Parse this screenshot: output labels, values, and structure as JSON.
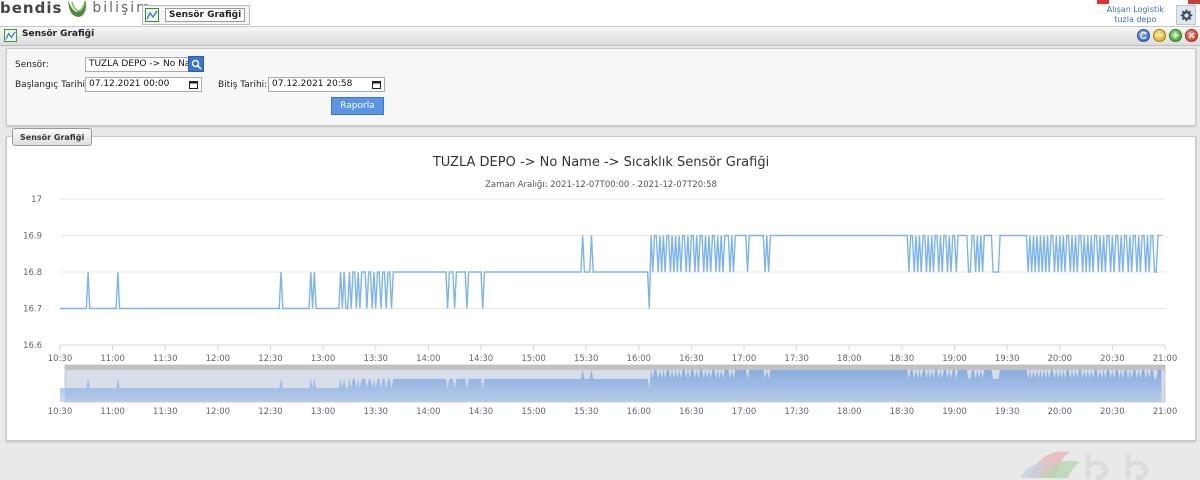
{
  "app": {
    "logo_left": "bendis",
    "logo_right": "bilişim",
    "open_tab": "Sensör Grafiği",
    "user_name": "Alışan Logistik",
    "user_site": "tuzla depo"
  },
  "window": {
    "title": "Sensör Grafiği"
  },
  "filters": {
    "sensor_label": "Sensör:",
    "sensor_value": "TUZLA DEPO -> No Name",
    "start_label": "Başlangıç Tarihi:",
    "start_value": "07.12.2021 00:00",
    "end_label": "Bitiş Tarihi:",
    "end_value": "07.12.2021 20:58",
    "report_button": "Raporla"
  },
  "section_tab": "Sensör Grafiği",
  "chart_data": {
    "type": "line",
    "title": "TUZLA DEPO -> No Name -> Sıcaklık Sensör Grafiği",
    "subtitle": "Zaman Aralığı: 2021-12-07T00:00 - 2021-12-07T20:58",
    "xlabel": "",
    "ylabel": "",
    "ylim": [
      16.6,
      17
    ],
    "yticks": [
      "17",
      "16.9",
      "16.8",
      "16.7",
      "16.6"
    ],
    "xticks": [
      "10:30",
      "11:00",
      "11:30",
      "12:00",
      "12:30",
      "13:00",
      "13:30",
      "14:00",
      "14:30",
      "15:00",
      "15:30",
      "16:00",
      "16:30",
      "17:00",
      "17:30",
      "18:00",
      "18:30",
      "19:00",
      "19:30",
      "20:00",
      "20:30",
      "21:00"
    ],
    "xlim": [
      "10:30",
      "21:00"
    ],
    "grid": "horizontal",
    "series_color": "#7cb5ec",
    "navigator": true,
    "x": [
      "10:30",
      "10:45",
      "10:46",
      "10:47",
      "11:02",
      "11:03",
      "11:04",
      "12:35",
      "12:36",
      "12:37",
      "12:52",
      "12:53",
      "12:54",
      "12:55",
      "12:56",
      "12:57",
      "13:09",
      "13:10",
      "13:11",
      "13:12",
      "13:13",
      "13:14",
      "13:15",
      "13:16",
      "13:17",
      "13:18",
      "13:19",
      "13:20",
      "13:21",
      "13:22",
      "13:23",
      "13:24",
      "13:25",
      "13:26",
      "13:27",
      "13:28",
      "13:29",
      "13:30",
      "13:31",
      "13:32",
      "13:33",
      "13:34",
      "13:35",
      "13:36",
      "13:37",
      "13:38",
      "13:39",
      "13:40",
      "13:41",
      "13:42",
      "13:43",
      "13:44",
      "13:45",
      "13:46",
      "13:47",
      "13:48",
      "13:49",
      "13:50",
      "13:51",
      "13:52",
      "13:53",
      "13:54",
      "14:10",
      "14:11",
      "14:12",
      "14:13",
      "14:14",
      "14:15",
      "14:16",
      "14:17",
      "14:18",
      "14:19",
      "14:20",
      "14:21",
      "14:22",
      "14:23",
      "14:24",
      "14:25",
      "14:26",
      "14:27",
      "14:28",
      "14:30",
      "14:31",
      "14:32",
      "15:27",
      "15:28",
      "15:29",
      "15:32",
      "15:33",
      "15:34",
      "16:05",
      "16:06",
      "16:07",
      "16:08",
      "16:09",
      "16:10",
      "16:11",
      "16:12",
      "16:13",
      "16:14",
      "16:15",
      "16:16",
      "16:17",
      "16:18",
      "16:19",
      "16:20",
      "16:21",
      "16:22",
      "16:23",
      "16:24",
      "16:25",
      "16:26",
      "16:27",
      "16:28",
      "16:29",
      "16:30",
      "16:31",
      "16:32",
      "16:33",
      "16:34",
      "16:35",
      "16:36",
      "16:37",
      "16:38",
      "16:39",
      "16:40",
      "16:41",
      "16:42",
      "16:43",
      "16:44",
      "16:45",
      "16:46",
      "16:47",
      "16:48",
      "16:49",
      "16:50",
      "16:51",
      "16:52",
      "16:53",
      "16:54",
      "16:55",
      "16:56",
      "16:57",
      "16:58",
      "16:59",
      "17:00",
      "17:01",
      "17:02",
      "17:03",
      "17:04",
      "17:05",
      "17:06",
      "17:07",
      "17:08",
      "17:09",
      "17:10",
      "17:11",
      "17:12",
      "17:13",
      "17:14",
      "17:15",
      "18:27",
      "18:28",
      "18:29",
      "18:30",
      "18:31",
      "18:32",
      "18:33",
      "18:34",
      "18:35",
      "18:36",
      "18:37",
      "18:38",
      "18:39",
      "18:40",
      "18:41",
      "18:42",
      "18:43",
      "18:44",
      "18:45",
      "18:46",
      "18:47",
      "18:48",
      "18:49",
      "18:50",
      "18:51",
      "18:52",
      "18:53",
      "18:54",
      "18:55",
      "18:56",
      "18:57",
      "18:58",
      "18:59",
      "19:00",
      "19:01",
      "19:02",
      "19:03",
      "19:04",
      "19:05",
      "19:06",
      "19:07",
      "19:08",
      "19:09",
      "19:10",
      "19:11",
      "19:12",
      "19:13",
      "19:14",
      "19:15",
      "19:16",
      "19:17",
      "19:18",
      "19:19",
      "19:20",
      "19:21",
      "19:22",
      "19:23",
      "19:24",
      "19:25",
      "19:26",
      "19:27",
      "19:28",
      "19:29",
      "19:30",
      "19:31",
      "19:32",
      "19:33",
      "19:34",
      "19:35",
      "19:36",
      "19:37",
      "19:38",
      "19:39",
      "19:40",
      "19:41",
      "19:42",
      "19:43",
      "19:44",
      "19:45",
      "19:46",
      "19:47",
      "19:48",
      "19:49",
      "19:50",
      "19:51",
      "19:52",
      "19:53",
      "19:54",
      "19:55",
      "19:56",
      "19:57",
      "19:58",
      "19:59",
      "20:00",
      "20:01",
      "20:02",
      "20:03",
      "20:04",
      "20:05",
      "20:06",
      "20:07",
      "20:08",
      "20:09",
      "20:10",
      "20:11",
      "20:12",
      "20:13",
      "20:14",
      "20:15",
      "20:16",
      "20:17",
      "20:18",
      "20:19",
      "20:20",
      "20:21",
      "20:22",
      "20:23",
      "20:24",
      "20:25",
      "20:26",
      "20:27",
      "20:28",
      "20:29",
      "20:30",
      "20:31",
      "20:32",
      "20:33",
      "20:34",
      "20:35",
      "20:36",
      "20:37",
      "20:38",
      "20:39",
      "20:40",
      "20:41",
      "20:42",
      "20:43",
      "20:44",
      "20:45",
      "20:46",
      "20:47",
      "20:48",
      "20:49",
      "20:50",
      "20:51",
      "20:52",
      "20:53",
      "20:54",
      "20:55",
      "20:56",
      "20:57",
      "20:58"
    ],
    "values": [
      16.7,
      16.7,
      16.8,
      16.7,
      16.7,
      16.8,
      16.7,
      16.7,
      16.8,
      16.7,
      16.7,
      16.8,
      16.7,
      16.8,
      16.7,
      16.7,
      16.7,
      16.8,
      16.7,
      16.8,
      16.7,
      16.7,
      16.8,
      16.7,
      16.8,
      16.8,
      16.7,
      16.8,
      16.7,
      16.8,
      16.8,
      16.8,
      16.7,
      16.8,
      16.8,
      16.7,
      16.8,
      16.7,
      16.8,
      16.8,
      16.7,
      16.8,
      16.8,
      16.7,
      16.8,
      16.8,
      16.7,
      16.8,
      16.8,
      16.8,
      16.8,
      16.8,
      16.8,
      16.8,
      16.8,
      16.8,
      16.8,
      16.8,
      16.8,
      16.8,
      16.8,
      16.8,
      16.8,
      16.7,
      16.8,
      16.8,
      16.8,
      16.7,
      16.8,
      16.8,
      16.8,
      16.8,
      16.8,
      16.8,
      16.7,
      16.8,
      16.8,
      16.8,
      16.8,
      16.8,
      16.8,
      16.8,
      16.7,
      16.8,
      16.8,
      16.9,
      16.8,
      16.8,
      16.9,
      16.8,
      16.8,
      16.7,
      16.9,
      16.8,
      16.9,
      16.9,
      16.8,
      16.9,
      16.8,
      16.9,
      16.8,
      16.9,
      16.9,
      16.8,
      16.9,
      16.8,
      16.9,
      16.8,
      16.9,
      16.8,
      16.9,
      16.9,
      16.8,
      16.9,
      16.8,
      16.9,
      16.9,
      16.8,
      16.9,
      16.8,
      16.9,
      16.9,
      16.8,
      16.9,
      16.8,
      16.9,
      16.8,
      16.9,
      16.9,
      16.8,
      16.9,
      16.8,
      16.9,
      16.8,
      16.9,
      16.9,
      16.9,
      16.8,
      16.9,
      16.8,
      16.9,
      16.9,
      16.9,
      16.9,
      16.9,
      16.9,
      16.9,
      16.8,
      16.9,
      16.9,
      16.9,
      16.9,
      16.9,
      16.9,
      16.9,
      16.9,
      16.9,
      16.8,
      16.9,
      16.8,
      16.9,
      16.9,
      16.9,
      16.9,
      16.9,
      16.9,
      16.9,
      16.9,
      16.8,
      16.9,
      16.9,
      16.8,
      16.9,
      16.8,
      16.9,
      16.8,
      16.9,
      16.9,
      16.8,
      16.9,
      16.8,
      16.9,
      16.8,
      16.9,
      16.9,
      16.8,
      16.9,
      16.8,
      16.9,
      16.9,
      16.8,
      16.9,
      16.8,
      16.9,
      16.9,
      16.8,
      16.9,
      16.9,
      16.9,
      16.9,
      16.9,
      16.9,
      16.8,
      16.8,
      16.9,
      16.9,
      16.8,
      16.9,
      16.8,
      16.9,
      16.8,
      16.9,
      16.9,
      16.9,
      16.9,
      16.9,
      16.8,
      16.8,
      16.8,
      16.8,
      16.9,
      16.9,
      16.9,
      16.9,
      16.9,
      16.9,
      16.9,
      16.9,
      16.9,
      16.9,
      16.9,
      16.9,
      16.9,
      16.9,
      16.9,
      16.9,
      16.8,
      16.9,
      16.8,
      16.9,
      16.8,
      16.9,
      16.8,
      16.9,
      16.8,
      16.9,
      16.8,
      16.9,
      16.8,
      16.9,
      16.9,
      16.8,
      16.9,
      16.8,
      16.9,
      16.8,
      16.9,
      16.8,
      16.9,
      16.9,
      16.8,
      16.9,
      16.8,
      16.9,
      16.8,
      16.9,
      16.9,
      16.8,
      16.9,
      16.8,
      16.9,
      16.8,
      16.9,
      16.8,
      16.9,
      16.9,
      16.8,
      16.9,
      16.8,
      16.9,
      16.8,
      16.9,
      16.9,
      16.8,
      16.9,
      16.8,
      16.9,
      16.9,
      16.8,
      16.9,
      16.8,
      16.9,
      16.9,
      16.8,
      16.9,
      16.8,
      16.9,
      16.9,
      16.8,
      16.9,
      16.8,
      16.9,
      16.9,
      16.8,
      16.9,
      16.8,
      16.9,
      16.9,
      16.8,
      16.8,
      16.9,
      16.9,
      16.9
    ]
  },
  "colors": {
    "accent": "#3b73d8",
    "line": "#7cb5ec",
    "navigator_fill": "#a9c6ea"
  }
}
